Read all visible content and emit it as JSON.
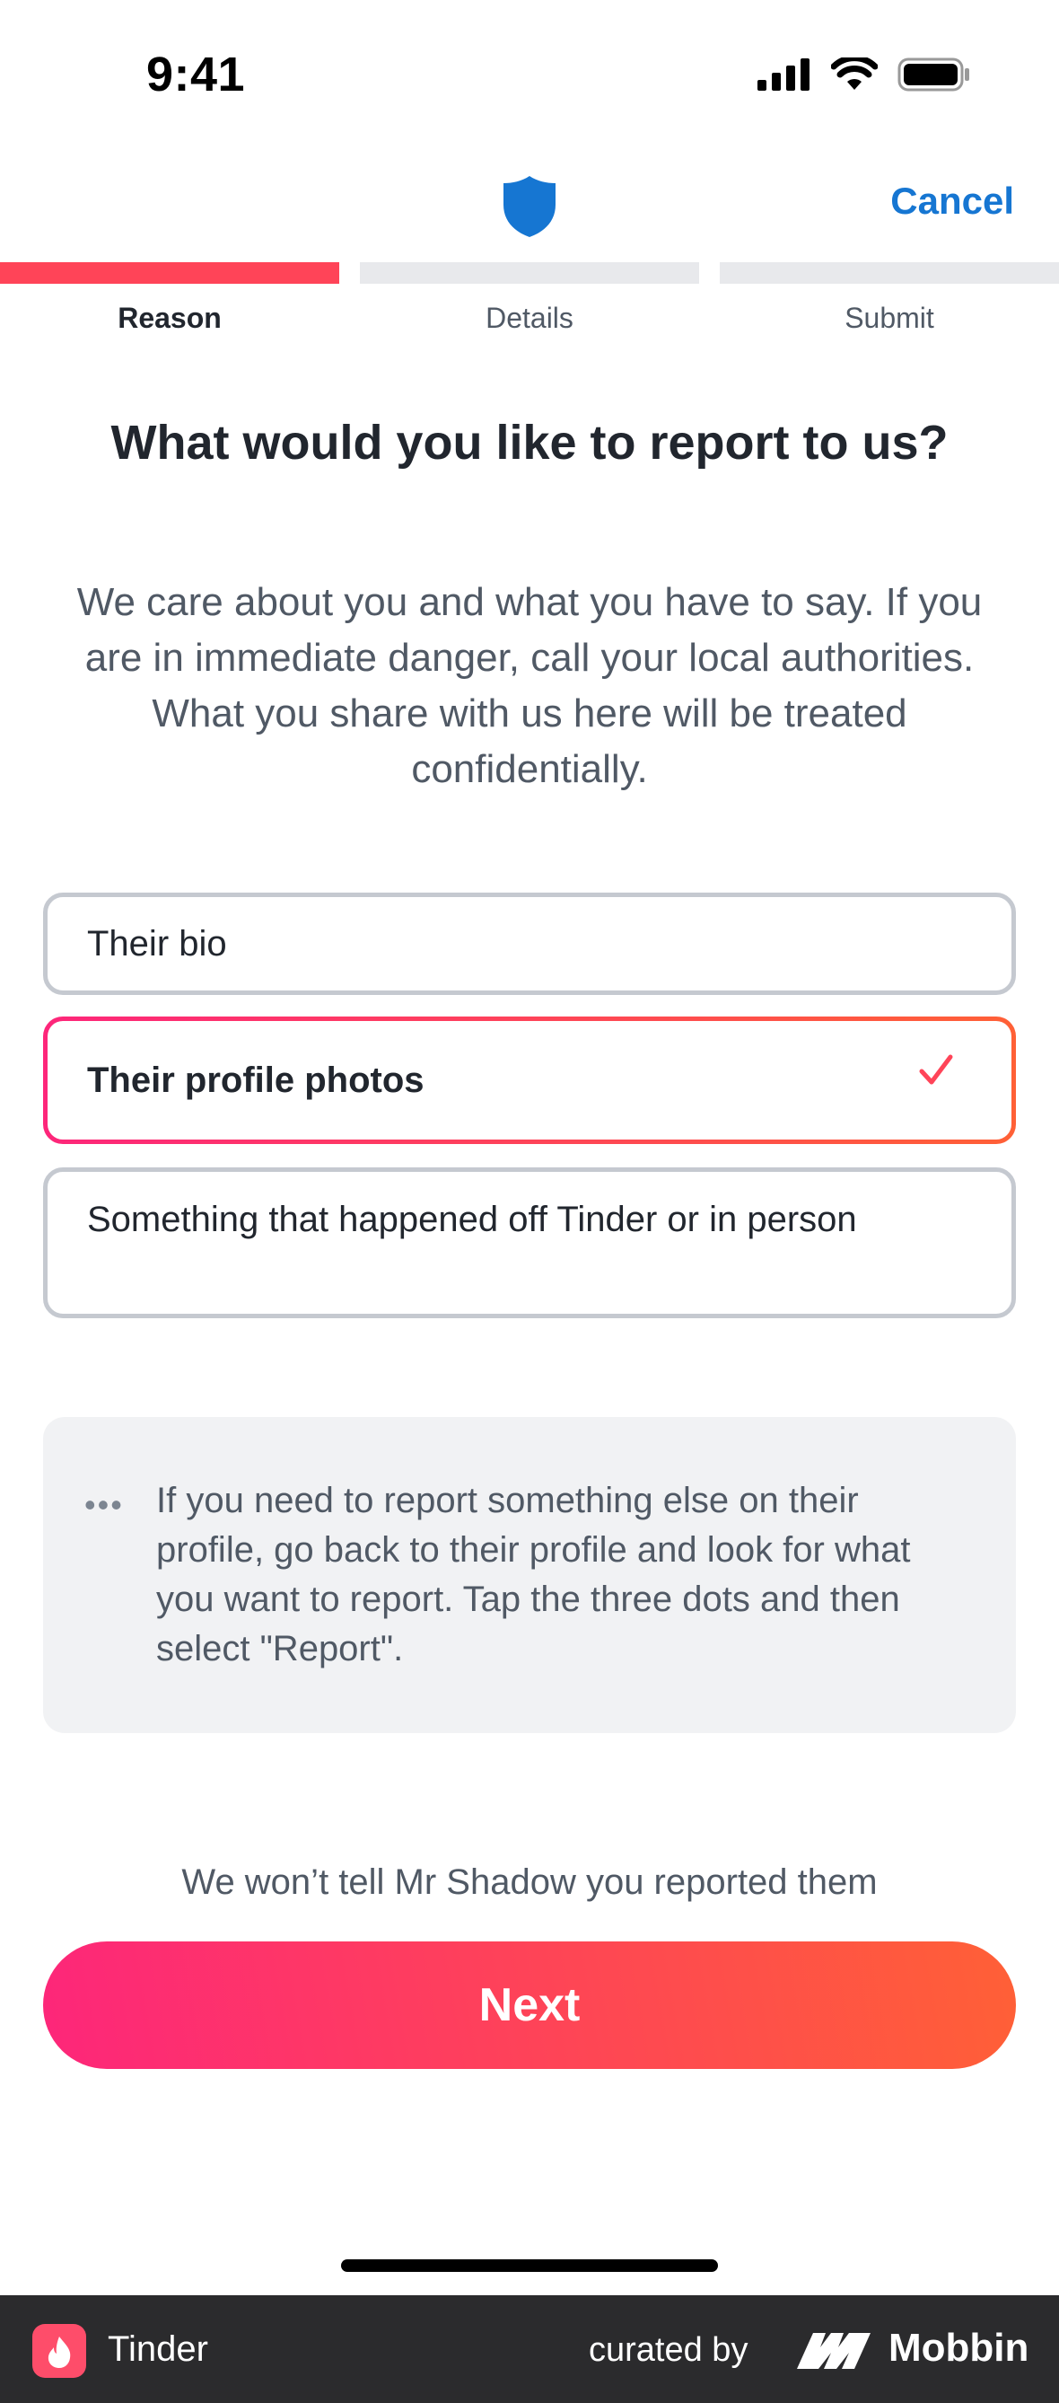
{
  "status_bar": {
    "time": "9:41"
  },
  "nav": {
    "cancel_label": "Cancel",
    "shield_color": "#1676d2"
  },
  "steps": [
    {
      "label": "Reason",
      "active": true
    },
    {
      "label": "Details",
      "active": false
    },
    {
      "label": "Submit",
      "active": false
    }
  ],
  "content": {
    "title": "What would you like to report to us?",
    "description": "We care about you and what you have to say. If you are in immediate danger, call your local authorities. What you share with us here will be treated confidentially."
  },
  "options": [
    {
      "label": "Their bio",
      "selected": false
    },
    {
      "label": "Their profile photos",
      "selected": true
    },
    {
      "label": "Something that happened off Tinder or in person",
      "selected": false
    }
  ],
  "info": {
    "dots_icon": "•••",
    "text": "If you need to report something else on their profile, go back to their profile and look for what you want to report. Tap the three dots and then select \"Report\"."
  },
  "notice": "We won’t tell Mr Shadow you reported them",
  "next_label": "Next",
  "footer": {
    "app_name": "Tinder",
    "curated_by": "curated by",
    "brand": "Mobbin"
  },
  "colors": {
    "accent_red": "#ff4458",
    "gradient_start": "#fd267a",
    "gradient_end": "#ff6036",
    "link_blue": "#1676d2"
  }
}
